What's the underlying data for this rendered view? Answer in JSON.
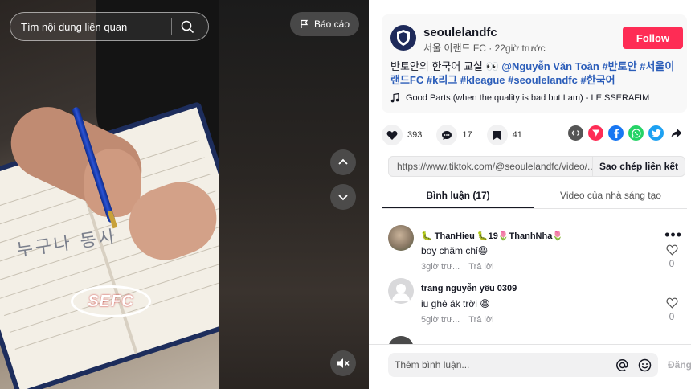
{
  "search": {
    "placeholder": "Tìm nội dung liên quan"
  },
  "report": {
    "label": "Báo cáo"
  },
  "video": {
    "watermark": "SEFC",
    "handwriting": "누구나 동사"
  },
  "author": {
    "username": "seoulelandfc",
    "display_name": "서울 이랜드 FC",
    "time": "22giờ trước",
    "follow_label": "Follow"
  },
  "caption": {
    "text": "반토안의 한국어 교실 👀",
    "mention": "@Nguyễn Văn Toàn",
    "hashtags": [
      "#반토안",
      "#서울이랜드FC",
      "#k리그",
      "#kleague",
      "#seoulelandfc",
      "#한국어"
    ]
  },
  "music": {
    "title": "Good Parts (when the quality is bad but I am) - LE SSERAFIM"
  },
  "stats": {
    "likes": "393",
    "comments": "17",
    "saves": "41"
  },
  "share_icons": [
    "embed-icon",
    "send-icon",
    "facebook-icon",
    "whatsapp-icon",
    "twitter-icon",
    "share-arrow-icon"
  ],
  "colors": {
    "follow": "#fe2c55",
    "hashtag": "#2b5db9",
    "facebook": "#1877f2",
    "whatsapp": "#25d366",
    "twitter": "#1da1f2",
    "send": "#fe2c55"
  },
  "link": {
    "url": "https://www.tiktok.com/@seoulelandfc/video/...",
    "copy_label": "Sao chép liên kết"
  },
  "tabs": [
    {
      "label": "Bình luận (17)",
      "active": true
    },
    {
      "label": "Video của nhà sáng tạo",
      "active": false
    }
  ],
  "comments": [
    {
      "name": "🐛 ThanHieu 🐛19🌷ThanhNha🌷",
      "text": "boy chăm chỉ😆",
      "time": "3giờ trư...",
      "reply": "Trả lời",
      "likes": "0"
    },
    {
      "name": "trang nguyễn yêu 0309",
      "text": "iu ghê ák trời 😆",
      "time": "5giờ trư...",
      "reply": "Trả lời",
      "likes": "0"
    }
  ],
  "comment_input": {
    "placeholder": "Thêm bình luận...",
    "post_label": "Đăng"
  }
}
